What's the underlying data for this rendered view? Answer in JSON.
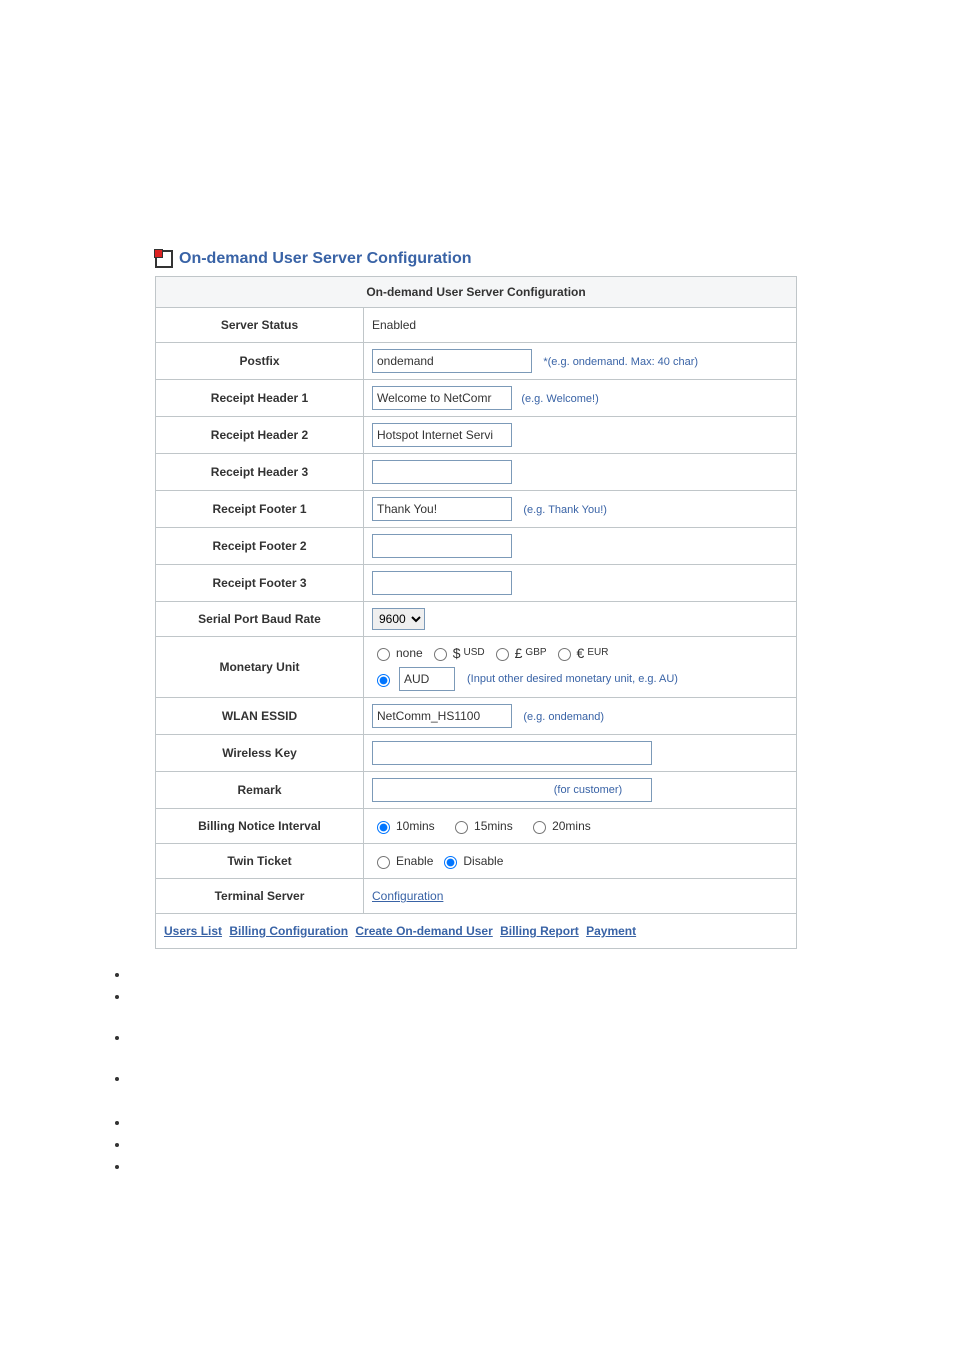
{
  "header": {
    "title": "On-demand User Server Configuration"
  },
  "table": {
    "caption": "On-demand User Server Configuration"
  },
  "rows": {
    "server_status": {
      "label": "Server Status",
      "value": "Enabled"
    },
    "postfix": {
      "label": "Postfix",
      "value": "ondemand",
      "hint": "*(e.g. ondemand. Max: 40 char)"
    },
    "rh1": {
      "label": "Receipt Header 1",
      "value": "Welcome to NetComr",
      "hint": "(e.g. Welcome!)"
    },
    "rh2": {
      "label": "Receipt Header 2",
      "value": "Hotspot Internet Servi"
    },
    "rh3": {
      "label": "Receipt Header 3",
      "value": ""
    },
    "rf1": {
      "label": "Receipt Footer 1",
      "value": "Thank You!",
      "hint": "(e.g. Thank You!)"
    },
    "rf2": {
      "label": "Receipt Footer 2",
      "value": ""
    },
    "rf3": {
      "label": "Receipt Footer 3",
      "value": ""
    },
    "baud": {
      "label": "Serial Port Baud Rate",
      "selected": "9600"
    },
    "monetary": {
      "label": "Monetary Unit",
      "options": {
        "none": "none",
        "usd_sym": "$",
        "usd_txt": "USD",
        "gbp_sym": "£",
        "gbp_txt": "GBP",
        "eur_sym": "€",
        "eur_txt": "EUR"
      },
      "other_value": "AUD",
      "hint": "(Input other desired monetary unit, e.g. AU)"
    },
    "essid": {
      "label": "WLAN ESSID",
      "value": "NetComm_HS1100",
      "hint": "(e.g. ondemand)"
    },
    "wkey": {
      "label": "Wireless Key",
      "value": ""
    },
    "remark": {
      "label": "Remark",
      "value": "",
      "hint": "(for customer)"
    },
    "billing": {
      "label": "Billing Notice Interval",
      "o1": "10mins",
      "o2": "15mins",
      "o3": "20mins"
    },
    "twin": {
      "label": "Twin Ticket",
      "o1": "Enable",
      "o2": "Disable"
    },
    "terminal": {
      "label": "Terminal Server",
      "link": "Configuration"
    }
  },
  "footer_links": {
    "l1": "Users List",
    "l2": "Billing Configuration",
    "l3": "Create On-demand User",
    "l4": "Billing Report",
    "l5": "Payment"
  }
}
